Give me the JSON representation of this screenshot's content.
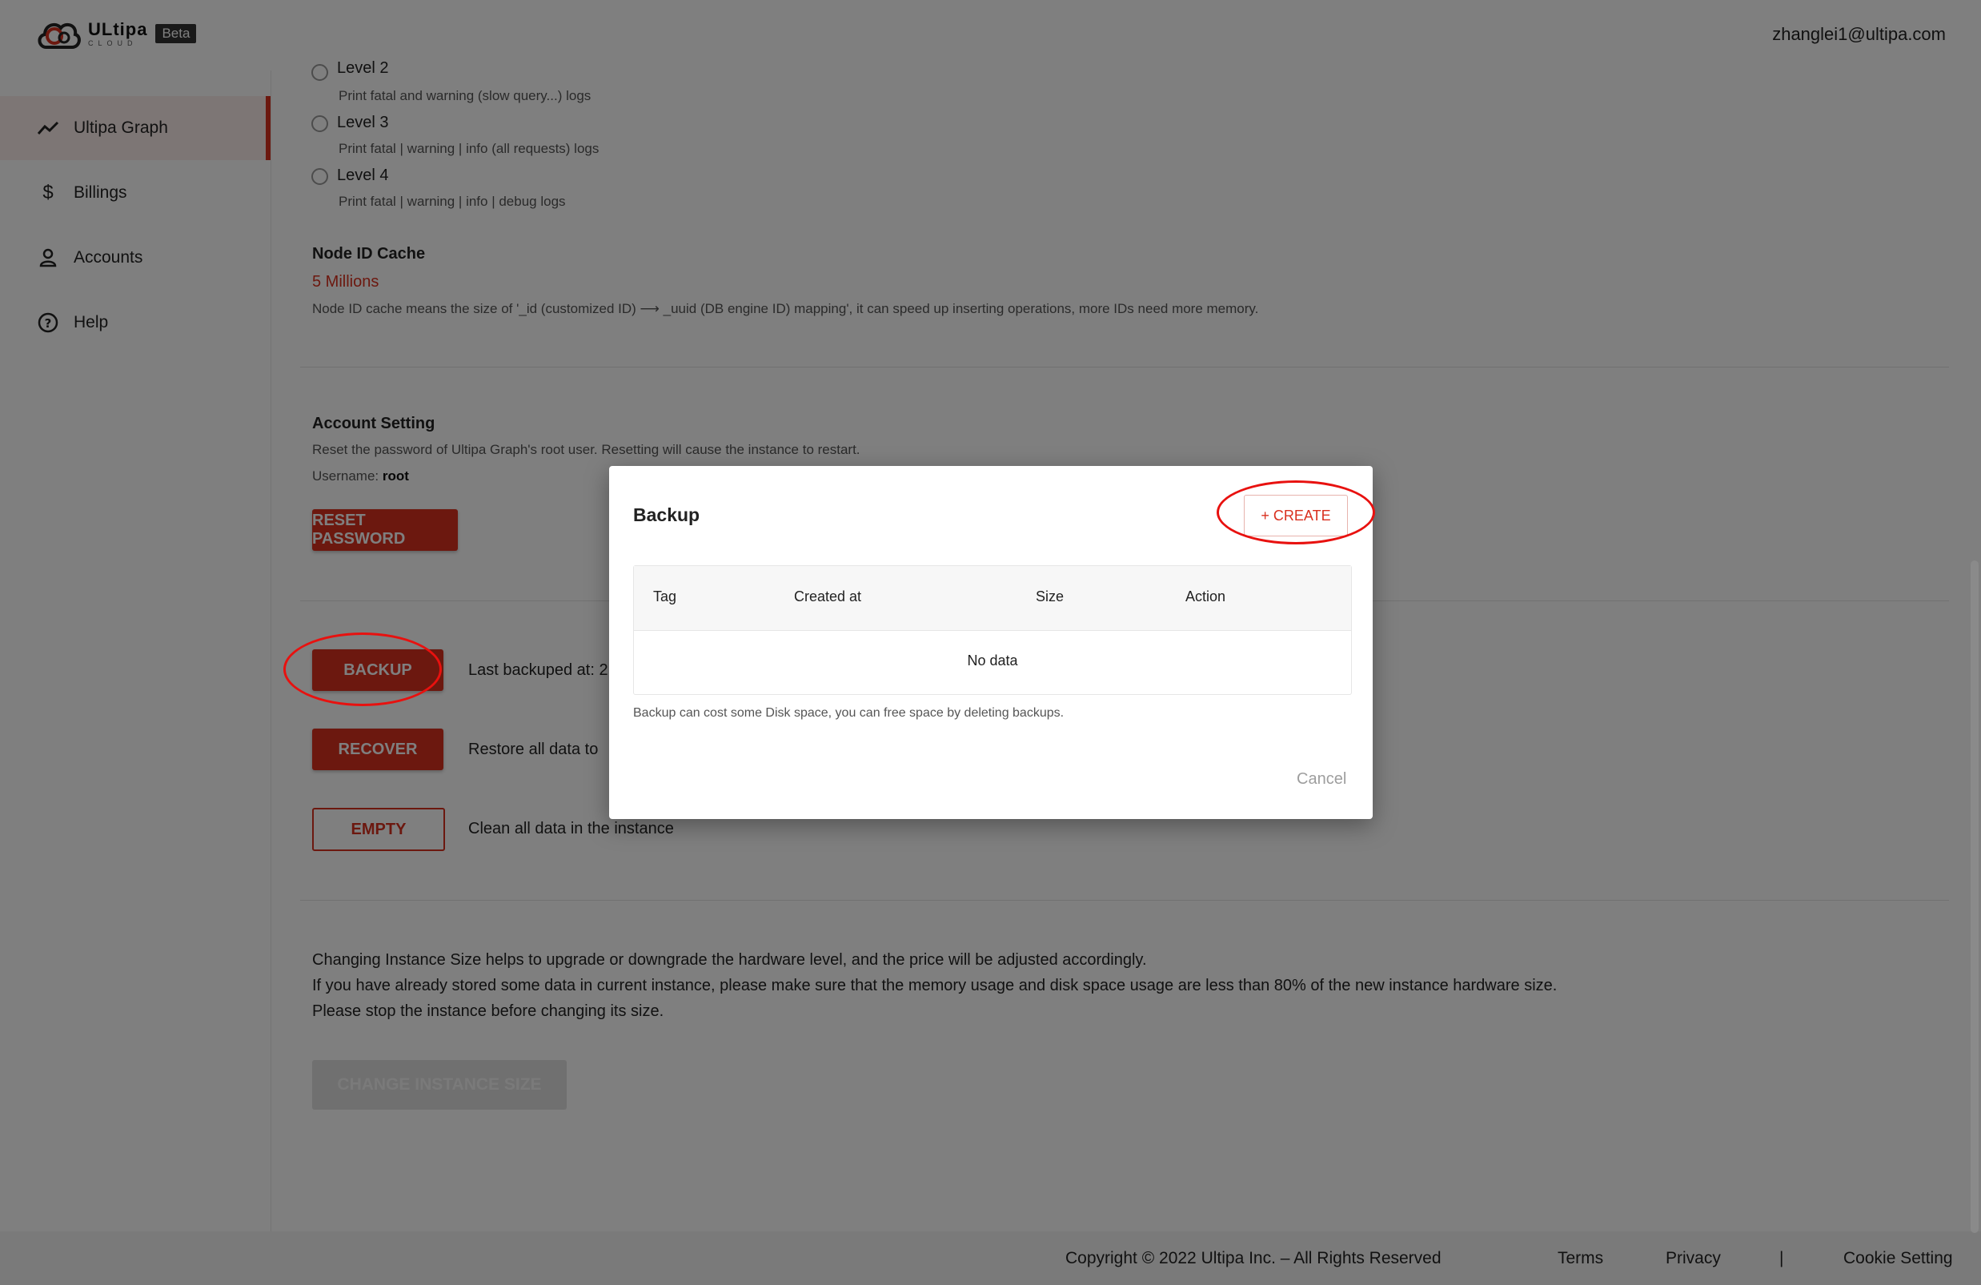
{
  "header": {
    "logo_word": "ULtipa",
    "logo_sub": "CLOUD",
    "beta": "Beta",
    "user_email": "zhanglei1@ultipa.com"
  },
  "sidebar": {
    "items": [
      {
        "label": "Ultipa Graph",
        "icon": "trend-line-icon",
        "active": true
      },
      {
        "label": "Billings",
        "icon": "dollar-icon"
      },
      {
        "label": "Accounts",
        "icon": "person-icon"
      },
      {
        "label": "Help",
        "icon": "help-circle-icon"
      }
    ]
  },
  "log_levels": {
    "level2_label": "Level 2",
    "level2_desc": "Print fatal and warning (slow query...) logs",
    "level3_label": "Level 3",
    "level3_desc": "Print fatal | warning | info (all requests) logs",
    "level4_label": "Level 4",
    "level4_desc": "Print fatal | warning | info | debug logs"
  },
  "node_cache": {
    "title": "Node ID Cache",
    "value": "5 Millions",
    "desc": "Node ID cache means the size of '_id (customized ID) ⟶ _uuid (DB engine ID) mapping', it can speed up inserting operations, more IDs need more memory."
  },
  "account_setting": {
    "title": "Account Setting",
    "desc": "Reset the password of Ultipa Graph's root user. Resetting will cause the instance to restart.",
    "username_label": "Username:",
    "username_value": "root",
    "reset_button": "RESET PASSWORD"
  },
  "data_ops": {
    "backup_button": "BACKUP",
    "backup_desc": "Last backuped at: 2",
    "recover_button": "RECOVER",
    "recover_desc": "Restore all data to",
    "empty_button": "EMPTY",
    "empty_desc": "Clean all data in the instance"
  },
  "instance_size": {
    "line1": "Changing Instance Size helps to upgrade or downgrade the hardware level, and the price will be adjusted accordingly.",
    "line2": "If you have already stored some data in current instance, please make sure that the memory usage and disk space usage are less than 80% of the new instance hardware size.",
    "line3": "Please stop the instance before changing its size.",
    "button": "CHANGE INSTANCE SIZE"
  },
  "footer": {
    "copyright": "Copyright © 2022 Ultipa Inc. – All Rights Reserved",
    "terms": "Terms",
    "privacy": "Privacy",
    "separator": "|",
    "cookie": "Cookie Setting"
  },
  "modal": {
    "title": "Backup",
    "create_button": "+ CREATE",
    "columns": [
      "Tag",
      "Created at",
      "Size",
      "Action"
    ],
    "empty_text": "No data",
    "note": "Backup can cost some Disk space, you can free space by deleting backups.",
    "cancel_button": "Cancel"
  },
  "colors": {
    "accent": "#d9301f",
    "annotation": "#e8110f",
    "overlay": "rgba(0,0,0,0.5)"
  }
}
